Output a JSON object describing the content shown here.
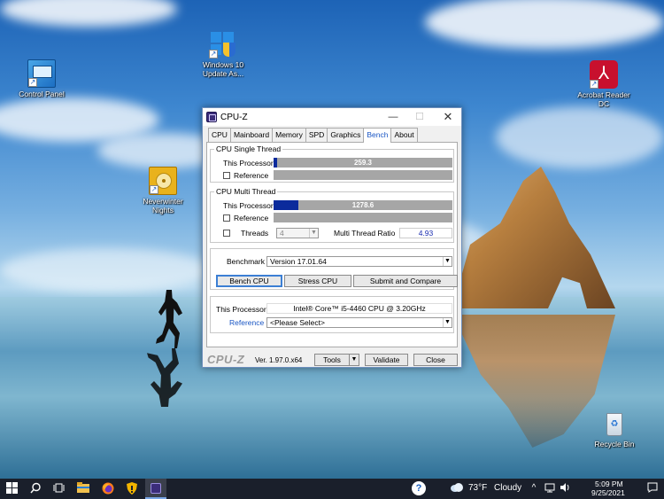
{
  "desktop": {
    "icons": [
      {
        "label": "Control Panel"
      },
      {
        "label": "Windows 10 Update As..."
      },
      {
        "label": "Neverwinter Nights"
      },
      {
        "label": "Acrobat Reader DC"
      },
      {
        "label": "Recycle Bin"
      }
    ]
  },
  "window": {
    "title": "CPU-Z",
    "tabs": [
      "CPU",
      "Mainboard",
      "Memory",
      "SPD",
      "Graphics",
      "Bench",
      "About"
    ],
    "active_tab": "Bench",
    "single_thread": {
      "group_title": "CPU Single Thread",
      "this_processor_label": "This Processor",
      "this_processor_value": "259.3",
      "this_processor_fill_fraction": 0.02,
      "reference_label": "Reference"
    },
    "multi_thread": {
      "group_title": "CPU Multi Thread",
      "this_processor_label": "This Processor",
      "this_processor_value": "1278.6",
      "this_processor_fill_fraction": 0.14,
      "reference_label": "Reference",
      "threads_label": "Threads",
      "threads_value": "4",
      "ratio_label": "Multi Thread Ratio",
      "ratio_value": "4.93"
    },
    "benchmark": {
      "label": "Benchmark",
      "version": "Version 17.01.64",
      "bench_cpu_button": "Bench CPU",
      "stress_cpu_button": "Stress CPU",
      "submit_button": "Submit and Compare"
    },
    "processor_info": {
      "this_processor_label": "This Processor",
      "this_processor_value": "Intel® Core™ i5-4460  CPU @ 3.20GHz",
      "reference_label": "Reference",
      "reference_value": "<Please Select>"
    },
    "footer": {
      "logo": "CPU-Z",
      "version": "Ver. 1.97.0.x64",
      "tools_button": "Tools",
      "validate_button": "Validate",
      "close_button": "Close"
    },
    "colors": {
      "bar_fill": "#0b2b9c",
      "bar_bg": "#a6a6a6",
      "readout_text": "#1a2db0"
    }
  },
  "taskbar": {
    "weather_temp": "73°F",
    "weather_desc": "Cloudy",
    "time": "5:09 PM",
    "date": "9/25/2021",
    "icons": [
      "windows-start-icon",
      "search-icon",
      "task-view-icon",
      "file-explorer-icon",
      "firefox-icon",
      "security-shield-icon",
      "cpuz-app-icon",
      "help-icon",
      "weather-cloud-icon",
      "chevron-up-icon",
      "network-icon",
      "volume-icon",
      "notification-icon"
    ]
  }
}
